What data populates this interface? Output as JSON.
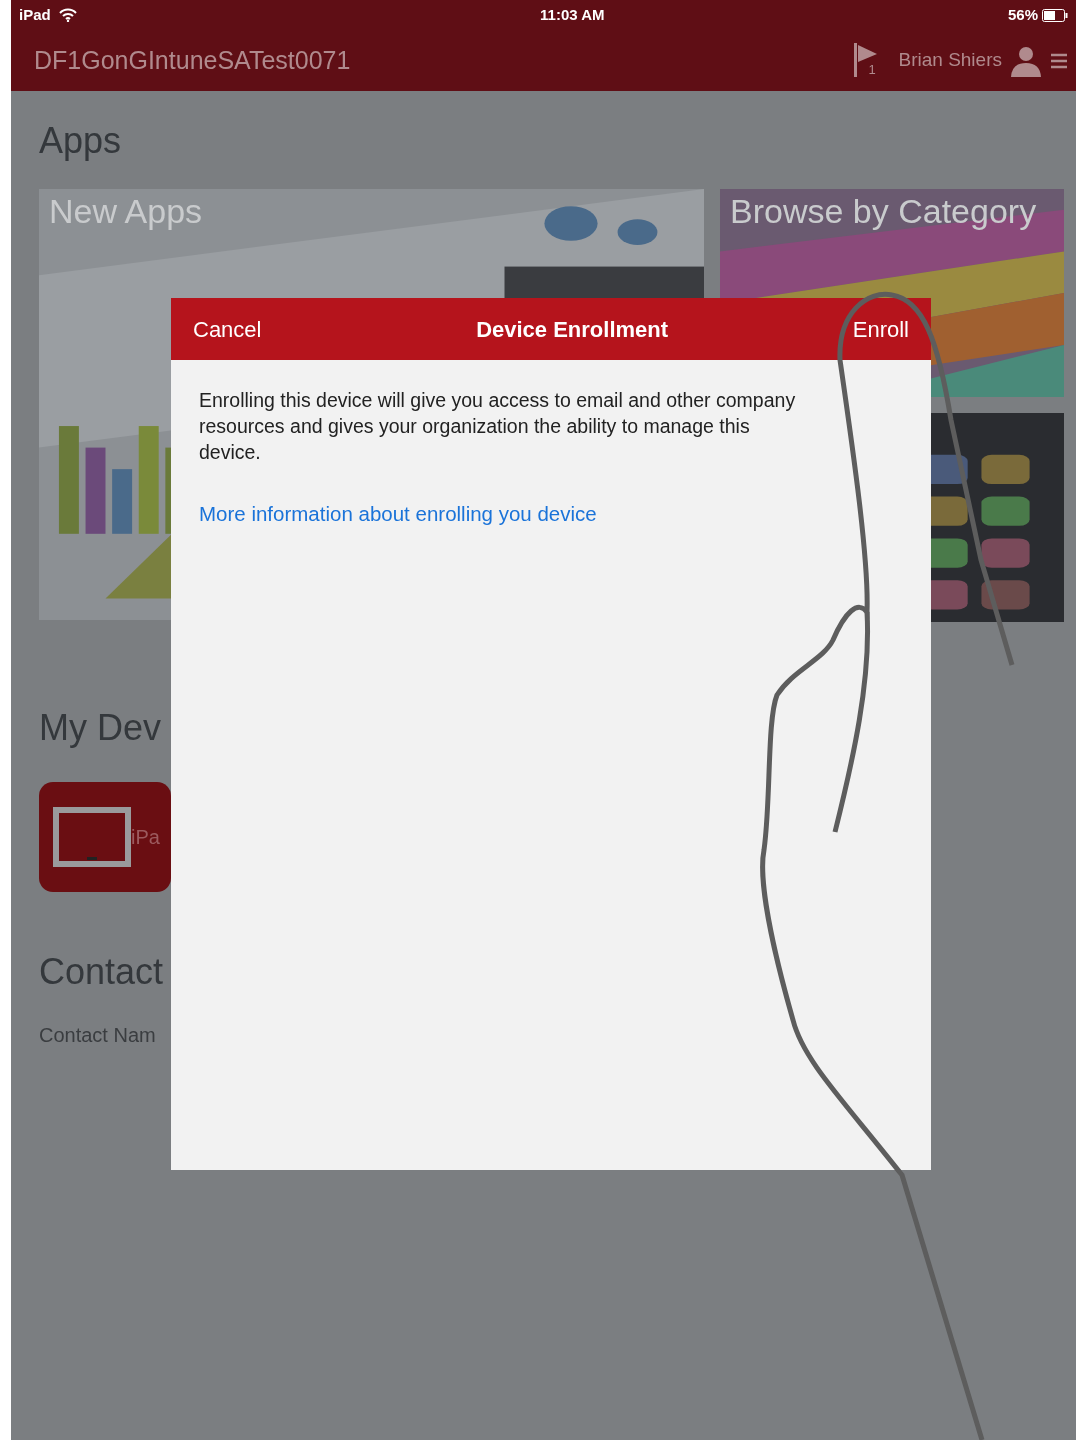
{
  "status_bar": {
    "carrier": "iPad",
    "time": "11:03 AM",
    "battery": "56%"
  },
  "nav_bar": {
    "title": "DF1GonGIntuneSATest0071",
    "flag_count": "1",
    "user": "Brian Shiers"
  },
  "apps": {
    "heading": "Apps",
    "tiles": [
      {
        "kind": "picture",
        "label": "New Apps"
      },
      {
        "kind": "picture",
        "label": "Browse by Category"
      },
      {
        "kind": "picture"
      }
    ]
  },
  "devices": {
    "heading": "My Dev",
    "items": [
      {
        "name": "iPa"
      }
    ]
  },
  "contact": {
    "heading": "Contact",
    "label": "Contact Nam"
  },
  "dialog": {
    "cancel": "Cancel",
    "title": "Device Enrollment",
    "confirm": "Enroll",
    "body": "Enrolling this device will give you access to email and other company resources and gives your organization the ability to manage this device.",
    "link": "More information about enrolling you device"
  }
}
